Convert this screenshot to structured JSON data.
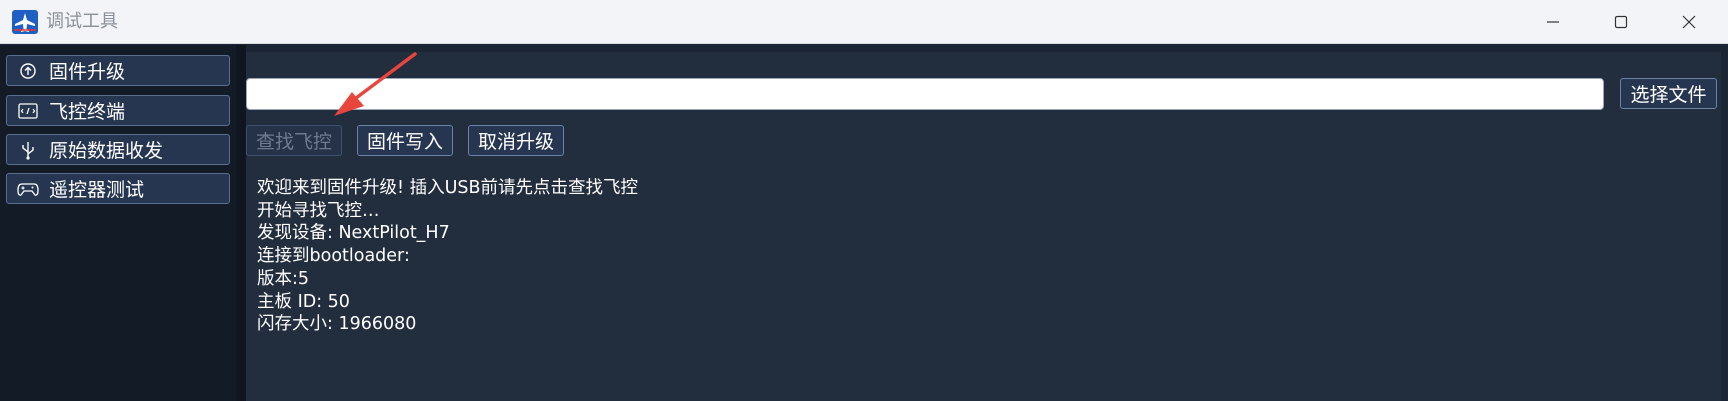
{
  "window": {
    "title": "调试工具",
    "app_icon": "plane-logo-icon",
    "controls": [
      "minimize-icon",
      "maximize-icon",
      "close-icon"
    ]
  },
  "sidebar": {
    "items": [
      {
        "label": "固件升级",
        "icon": "firmware-upload-icon"
      },
      {
        "label": "飞控终端",
        "icon": "terminal-icon"
      },
      {
        "label": "原始数据收发",
        "icon": "usb-icon"
      },
      {
        "label": "遥控器测试",
        "icon": "gamepad-icon"
      }
    ]
  },
  "main": {
    "file_path": {
      "value": "",
      "placeholder": ""
    },
    "choose_file_label": "选择文件",
    "find_fc_label": "查找飞控",
    "write_firmware_label": "固件写入",
    "cancel_upgrade_label": "取消升级",
    "log_lines": [
      "欢迎来到固件升级! 插入USB前请先点击查找飞控",
      "开始寻找飞控…",
      "发现设备: NextPilot_H7",
      "连接到bootloader:",
      "版本:5",
      "主板 ID: 50",
      "闪存大小: 1966080"
    ]
  },
  "annotation": {
    "arrow_color": "#e8453c"
  }
}
